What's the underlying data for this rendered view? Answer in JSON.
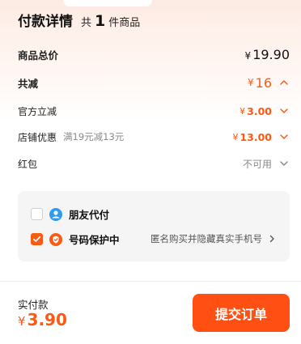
{
  "header": {
    "title": "付款详情",
    "count_prefix": "共",
    "count": "1",
    "count_suffix": "件商品"
  },
  "summary": {
    "total_label": "商品总价",
    "total_currency": "¥",
    "total_value": "19.90",
    "discount_label": "共减",
    "discount_currency": "¥",
    "discount_value": "16",
    "official_label": "官方立减",
    "official_currency": "¥",
    "official_value": "3.00",
    "store_label": "店铺优惠",
    "store_note": "满19元减13元",
    "store_currency": "¥",
    "store_value": "13.00",
    "redpacket_label": "红包",
    "redpacket_status": "不可用"
  },
  "options": {
    "friend_pay_label": "朋友代付",
    "friend_pay_checked": false,
    "number_protect_label": "号码保护中",
    "number_protect_checked": true,
    "number_protect_desc": "匿名购买并隐藏真实手机号"
  },
  "footer": {
    "pay_label": "实付款",
    "pay_currency": "¥",
    "pay_value": "3.90",
    "submit_label": "提交订单"
  },
  "colors": {
    "accent": "#fa5a14",
    "button": "#ff4f12",
    "card_bg": "#f5f5f5",
    "friend_icon": "#2d9cf0"
  }
}
